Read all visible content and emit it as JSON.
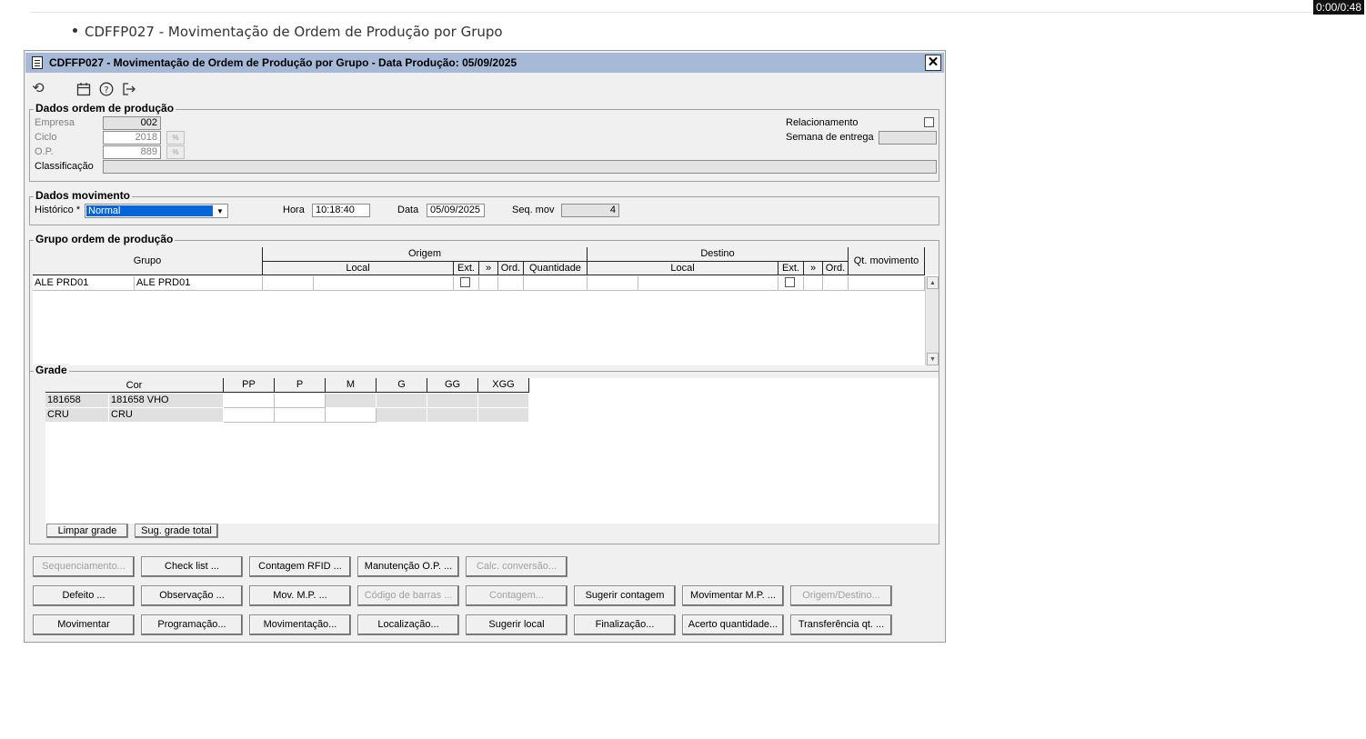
{
  "timer": "0:00/0:48",
  "heading": "CDFFP027 - Movimentação de Ordem de Produção por Grupo",
  "window": {
    "title": "CDFFP027 - Movimentação de Ordem de Produção por Grupo - Data Produção: 05/09/2025",
    "close_label": "✕"
  },
  "toolbar": {
    "icons": [
      "refresh-icon",
      "calendar-icon",
      "help-icon",
      "exit-icon"
    ]
  },
  "dados_ordem": {
    "title": "Dados ordem de produção",
    "empresa_label": "Empresa",
    "empresa_value": "002",
    "ciclo_label": "Ciclo",
    "ciclo_value": "2018",
    "op_label": "O.P.",
    "op_value": "889",
    "classificacao_label": "Classificação",
    "classificacao_value": "",
    "relacionamento_label": "Relacionamento",
    "semana_label": "Semana de entrega",
    "semana_value": ""
  },
  "dados_mov": {
    "title": "Dados movimento",
    "historico_label": "Histórico *",
    "historico_value": "Normal",
    "hora_label": "Hora",
    "hora_value": "10:18:40",
    "data_label": "Data",
    "data_value": "05/09/2025",
    "seq_label": "Seq. mov",
    "seq_value": "4"
  },
  "grupo_op": {
    "title": "Grupo ordem de produção",
    "headers": {
      "grupo": "Grupo",
      "origem": "Origem",
      "destino": "Destino",
      "local": "Local",
      "ext": "Ext.",
      "arrows": "»",
      "ord": "Ord.",
      "quantidade": "Quantidade",
      "qt_movimento": "Qt. movimento"
    },
    "rows": [
      {
        "grupo_code": "ALE PRD01",
        "grupo_desc": "ALE PRD01"
      }
    ]
  },
  "grade": {
    "title": "Grade",
    "cor_header": "Cor",
    "sizes": [
      "PP",
      "P",
      "M",
      "G",
      "GG",
      "XGG"
    ],
    "rows": [
      {
        "code": "181658",
        "desc": "181658 VHO"
      },
      {
        "code": "CRU",
        "desc": "CRU"
      }
    ],
    "limpar_label": "Limpar grade",
    "sugestao_label": "Sug. grade total"
  },
  "buttons": {
    "row1": [
      "Sequenciamento...",
      "Check list ...",
      "Contagem RFID ...",
      "Manutenção O.P. ...",
      "Calc. conversão..."
    ],
    "row2": [
      "Defeito ...",
      "Observação ...",
      "Mov. M.P. ...",
      "Código de barras ...",
      "Contagem...",
      "Sugerir contagem",
      "Movimentar M.P. ...",
      "Origem/Destino..."
    ],
    "row3": [
      "Movimentar",
      "Programação...",
      "Movimentação...",
      "Localização...",
      "Sugerir local",
      "Finalização...",
      "Acerto quantidade...",
      "Transferência qt. ..."
    ]
  }
}
